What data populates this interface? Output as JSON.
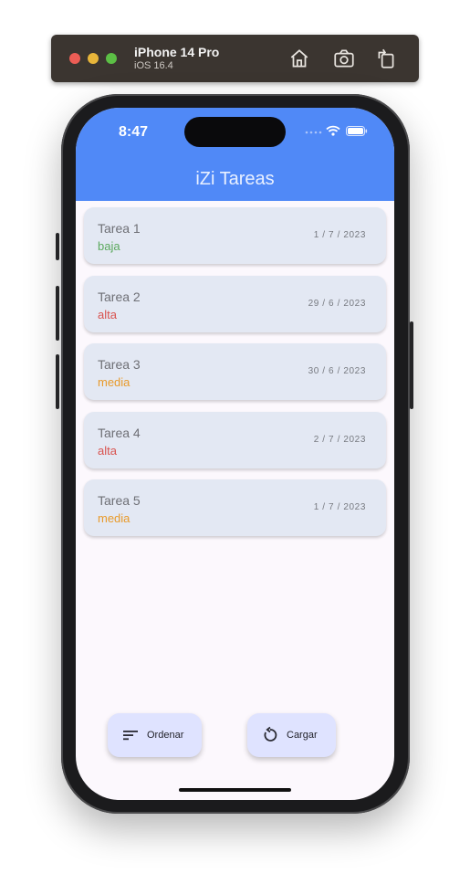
{
  "simulator": {
    "device_name": "iPhone 14 Pro",
    "os_version": "iOS 16.4",
    "toolbar_icons": [
      "home-icon",
      "screenshot-icon",
      "rotate-icon"
    ]
  },
  "status_bar": {
    "time": "8:47",
    "icons": [
      "cellular-icon",
      "wifi-icon",
      "battery-icon"
    ]
  },
  "app": {
    "title": "iZi Tareas",
    "accent_color": "#5089f7"
  },
  "priority_colors": {
    "baja": "#5ca95e",
    "alta": "#d9534f",
    "media": "#e89a2a"
  },
  "tasks": [
    {
      "title": "Tarea 1",
      "priority": "baja",
      "date": "1 / 7 / 2023"
    },
    {
      "title": "Tarea 2",
      "priority": "alta",
      "date": "29 / 6 / 2023"
    },
    {
      "title": "Tarea 3",
      "priority": "media",
      "date": "30 / 6 / 2023"
    },
    {
      "title": "Tarea 4",
      "priority": "alta",
      "date": "2 / 7 / 2023"
    },
    {
      "title": "Tarea 5",
      "priority": "media",
      "date": "1 / 7 / 2023"
    }
  ],
  "actions": {
    "sort": {
      "label": "Ordenar",
      "icon": "sort-icon"
    },
    "load": {
      "label": "Cargar",
      "icon": "refresh-icon"
    }
  }
}
